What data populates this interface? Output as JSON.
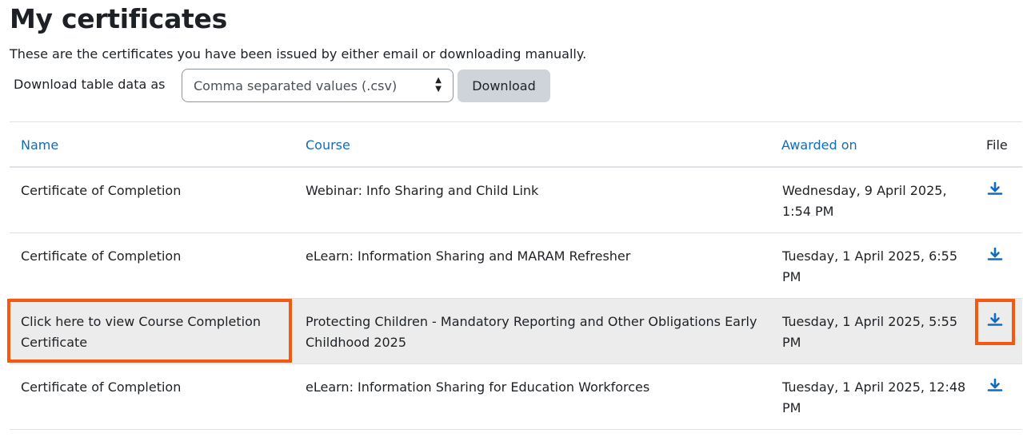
{
  "page": {
    "title": "My certificates",
    "intro": "These are the certificates you have been issued by either email or downloading manually."
  },
  "download": {
    "label": "Download table data as",
    "selected_format": "Comma separated values (.csv)",
    "button_label": "Download"
  },
  "table": {
    "headers": {
      "name": "Name",
      "course": "Course",
      "awarded_on": "Awarded on",
      "file": "File"
    },
    "rows": [
      {
        "name": "Certificate of Completion",
        "course": "Webinar: Info Sharing and Child Link",
        "awarded_on": "Wednesday, 9 April 2025, 1:54 PM",
        "file_icon": "download-icon"
      },
      {
        "name": "Certificate of Completion",
        "course": "eLearn: Information Sharing and MARAM Refresher",
        "awarded_on": "Tuesday, 1 April 2025, 6:55 PM",
        "file_icon": "download-icon"
      },
      {
        "name": "Click here to view Course Completion Certificate",
        "course": "Protecting Children - Mandatory Reporting and Other Obligations Early Childhood 2025",
        "awarded_on": "Tuesday, 1 April 2025, 5:55 PM",
        "file_icon": "download-icon",
        "highlighted": true
      },
      {
        "name": "Certificate of Completion",
        "course": "eLearn: Information Sharing for Education Workforces",
        "awarded_on": "Tuesday, 1 April 2025, 12:48 PM",
        "file_icon": "download-icon"
      }
    ]
  },
  "colors": {
    "link": "#0f6cbf",
    "highlight": "#f35a0f",
    "button_bg": "#ced4da",
    "row_alt": "#f5f5f5"
  }
}
